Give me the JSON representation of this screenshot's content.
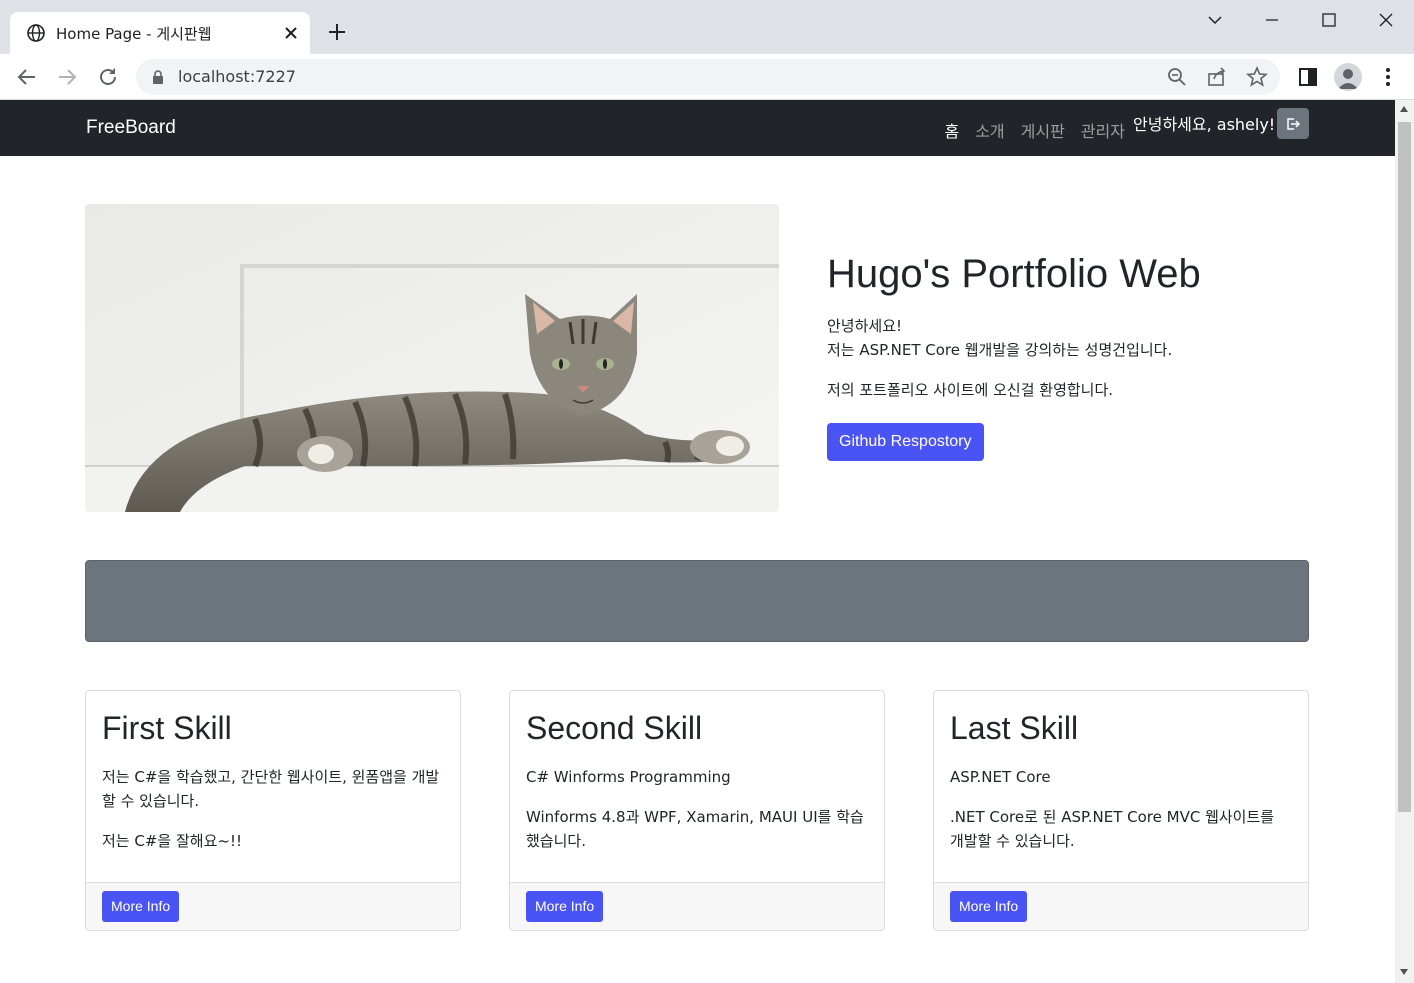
{
  "browser": {
    "tab_title": "Home Page - 게시판웹",
    "url": "localhost:7227"
  },
  "navbar": {
    "brand": "FreeBoard",
    "links": [
      {
        "label": "홈"
      },
      {
        "label": "소개"
      },
      {
        "label": "게시판"
      },
      {
        "label": "관리자"
      }
    ],
    "greeting": "안녕하세요, ashely!"
  },
  "hero": {
    "title": "Hugo's Portfolio Web",
    "line1": "안녕하세요!",
    "line2": "저는 ASP.NET Core 웹개발을 강의하는 성명건입니다.",
    "line3": "저의 포트폴리오 사이트에 오신걸 환영합니다.",
    "button": "Github Respostory"
  },
  "cards": [
    {
      "title": "First Skill",
      "text1": "저는 C#을 학습했고, 간단한 웹사이트, 윈폼앱을 개발할 수 있습니다.",
      "text2": "저는 C#을 잘해요~!!",
      "button": "More Info"
    },
    {
      "title": "Second Skill",
      "text1": "C# Winforms Programming",
      "text2": "Winforms 4.8과 WPF, Xamarin, MAUI UI를 학습했습니다.",
      "button": "More Info"
    },
    {
      "title": "Last Skill",
      "text1": "ASP.NET Core",
      "text2": ".NET Core로 된 ASP.NET Core MVC 웹사이트를 개발할 수 있습니다.",
      "button": "More Info"
    }
  ],
  "colors": {
    "primary": "#4a54f5",
    "navbar": "#212529",
    "banner": "#6c757d"
  }
}
